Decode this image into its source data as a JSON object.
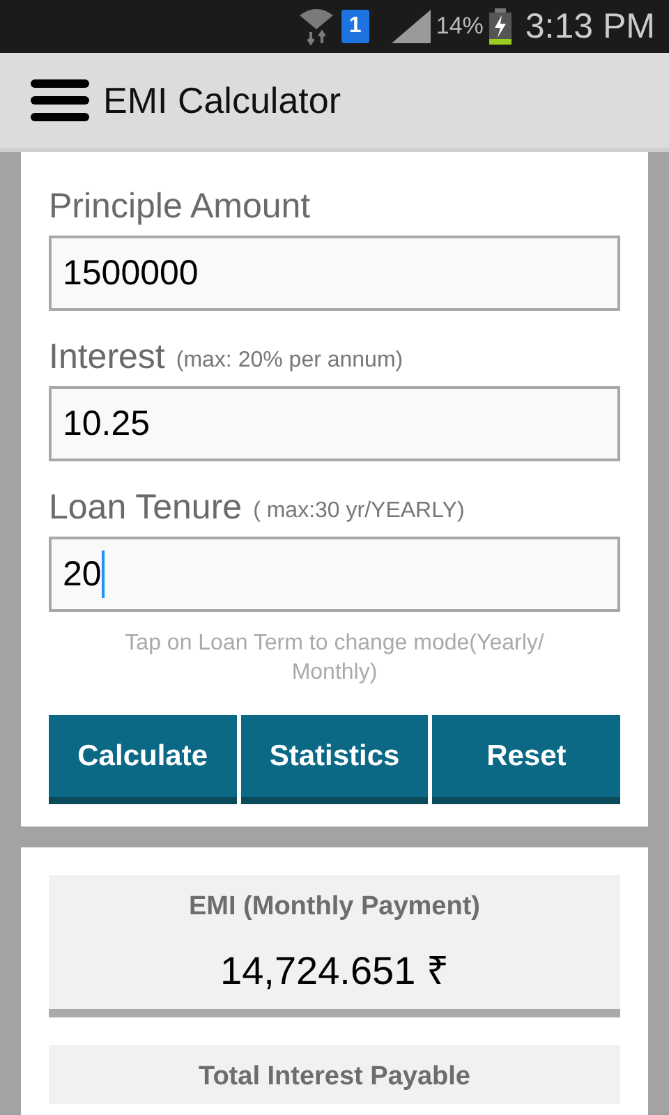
{
  "status_bar": {
    "sim_badge": "1",
    "battery_percent": "14%",
    "time": "3:13 PM",
    "charging": true
  },
  "toolbar": {
    "title": "EMI Calculator"
  },
  "fields": [
    {
      "label": "Principle Amount",
      "value": "1500000",
      "focused": false
    },
    {
      "label": "Interest",
      "hint": "(max: 20% per annum)",
      "value": "10.25",
      "focused": false
    },
    {
      "label": "Loan Tenure",
      "hint": "( max:30 yr/YEARLY)",
      "value": "20",
      "focused": true
    }
  ],
  "note": "Tap on Loan Term to change mode(Yearly/ Monthly)",
  "buttons": [
    "Calculate",
    "Statistics",
    "Reset"
  ],
  "results": [
    {
      "title": "EMI (Monthly Payment)",
      "value": "14,724.651 ₹"
    },
    {
      "title": "Total Interest Payable"
    }
  ]
}
